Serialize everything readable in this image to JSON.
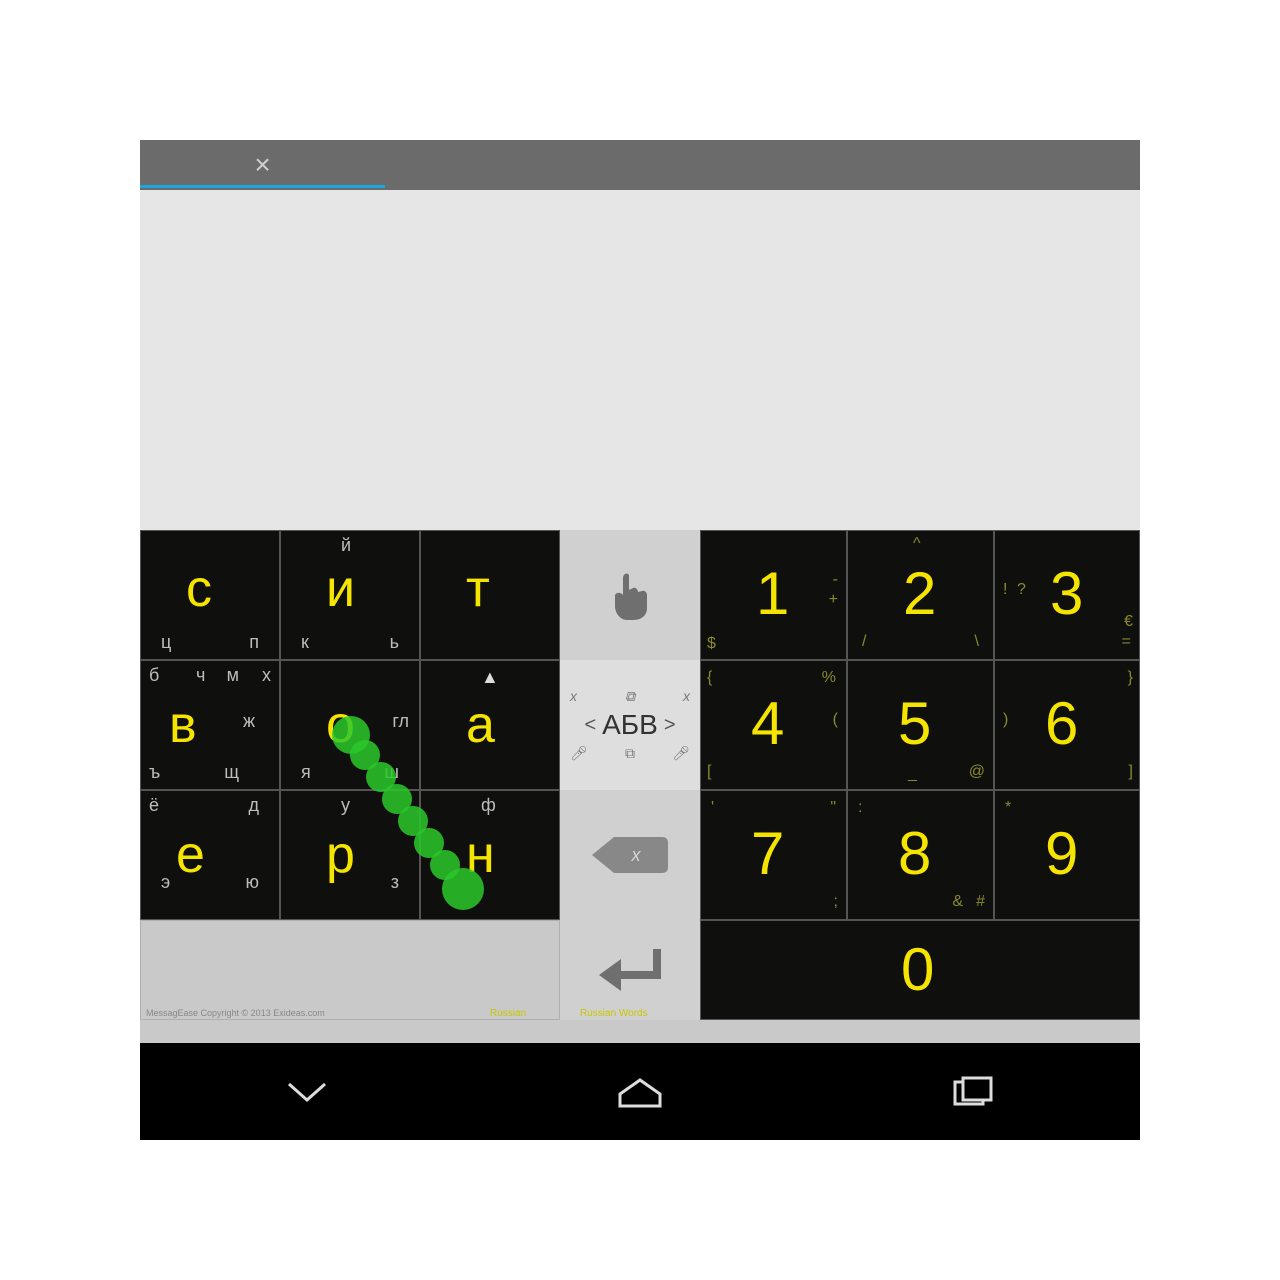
{
  "topbar": {
    "close_label": "×"
  },
  "keyboard": {
    "left_grid": [
      [
        {
          "main": "с",
          "top": "",
          "sub": [
            "ц",
            "п"
          ]
        },
        {
          "main": "и",
          "top": "й",
          "sub": [
            "к",
            "ь"
          ]
        },
        {
          "main": "т",
          "top": "",
          "sub": []
        }
      ],
      [
        {
          "main": "в",
          "top": "б",
          "sub": [
            "ж"
          ],
          "extra": [
            "ч",
            "м",
            "х",
            "ъ",
            "щ"
          ]
        },
        {
          "main": "о",
          "top": "",
          "sub": [
            "гл",
            "я",
            "ш"
          ]
        },
        {
          "main": "а",
          "top": "▲",
          "sub": []
        }
      ],
      [
        {
          "main": "е",
          "top": "ё",
          "sub": [
            "э",
            "ю"
          ],
          "extra": [
            "д"
          ]
        },
        {
          "main": "р",
          "top": "",
          "sub": [
            "з"
          ],
          "extra": [
            "у"
          ]
        },
        {
          "main": "н",
          "top": "",
          "sub": [],
          "extra": [
            "ф"
          ]
        }
      ]
    ],
    "middle": {
      "pointer_label": "",
      "mode_label": "АБВ",
      "mode_left": "<",
      "mode_right": ">",
      "backspace_label": "x",
      "enter_label": ""
    },
    "right_grid": [
      [
        {
          "main": "1",
          "syms": [
            "-",
            "+"
          ]
        },
        {
          "main": "2",
          "syms": [
            "^",
            "/",
            "\\"
          ]
        },
        {
          "main": "3",
          "syms": [
            "!",
            "?",
            "="
          ]
        }
      ],
      [
        {
          "main": "4",
          "syms": [
            "{",
            "[",
            "%",
            "("
          ]
        },
        {
          "main": "5",
          "syms": [
            "_",
            "@"
          ]
        },
        {
          "main": "6",
          "syms": [
            ")",
            "]",
            "}"
          ]
        }
      ],
      [
        {
          "main": "7",
          "syms": [
            "'",
            "\"",
            ";"
          ]
        },
        {
          "main": "8",
          "syms": [
            ":",
            "&",
            "#"
          ]
        },
        {
          "main": "9",
          "syms": [
            "*"
          ]
        }
      ],
      [
        {
          "main": "0",
          "syms": []
        }
      ]
    ]
  },
  "footer": {
    "copyright": "MessagEase Copyright © 2013 Exideas.com",
    "lang1": "Russian",
    "lang2": "Russian Words"
  }
}
